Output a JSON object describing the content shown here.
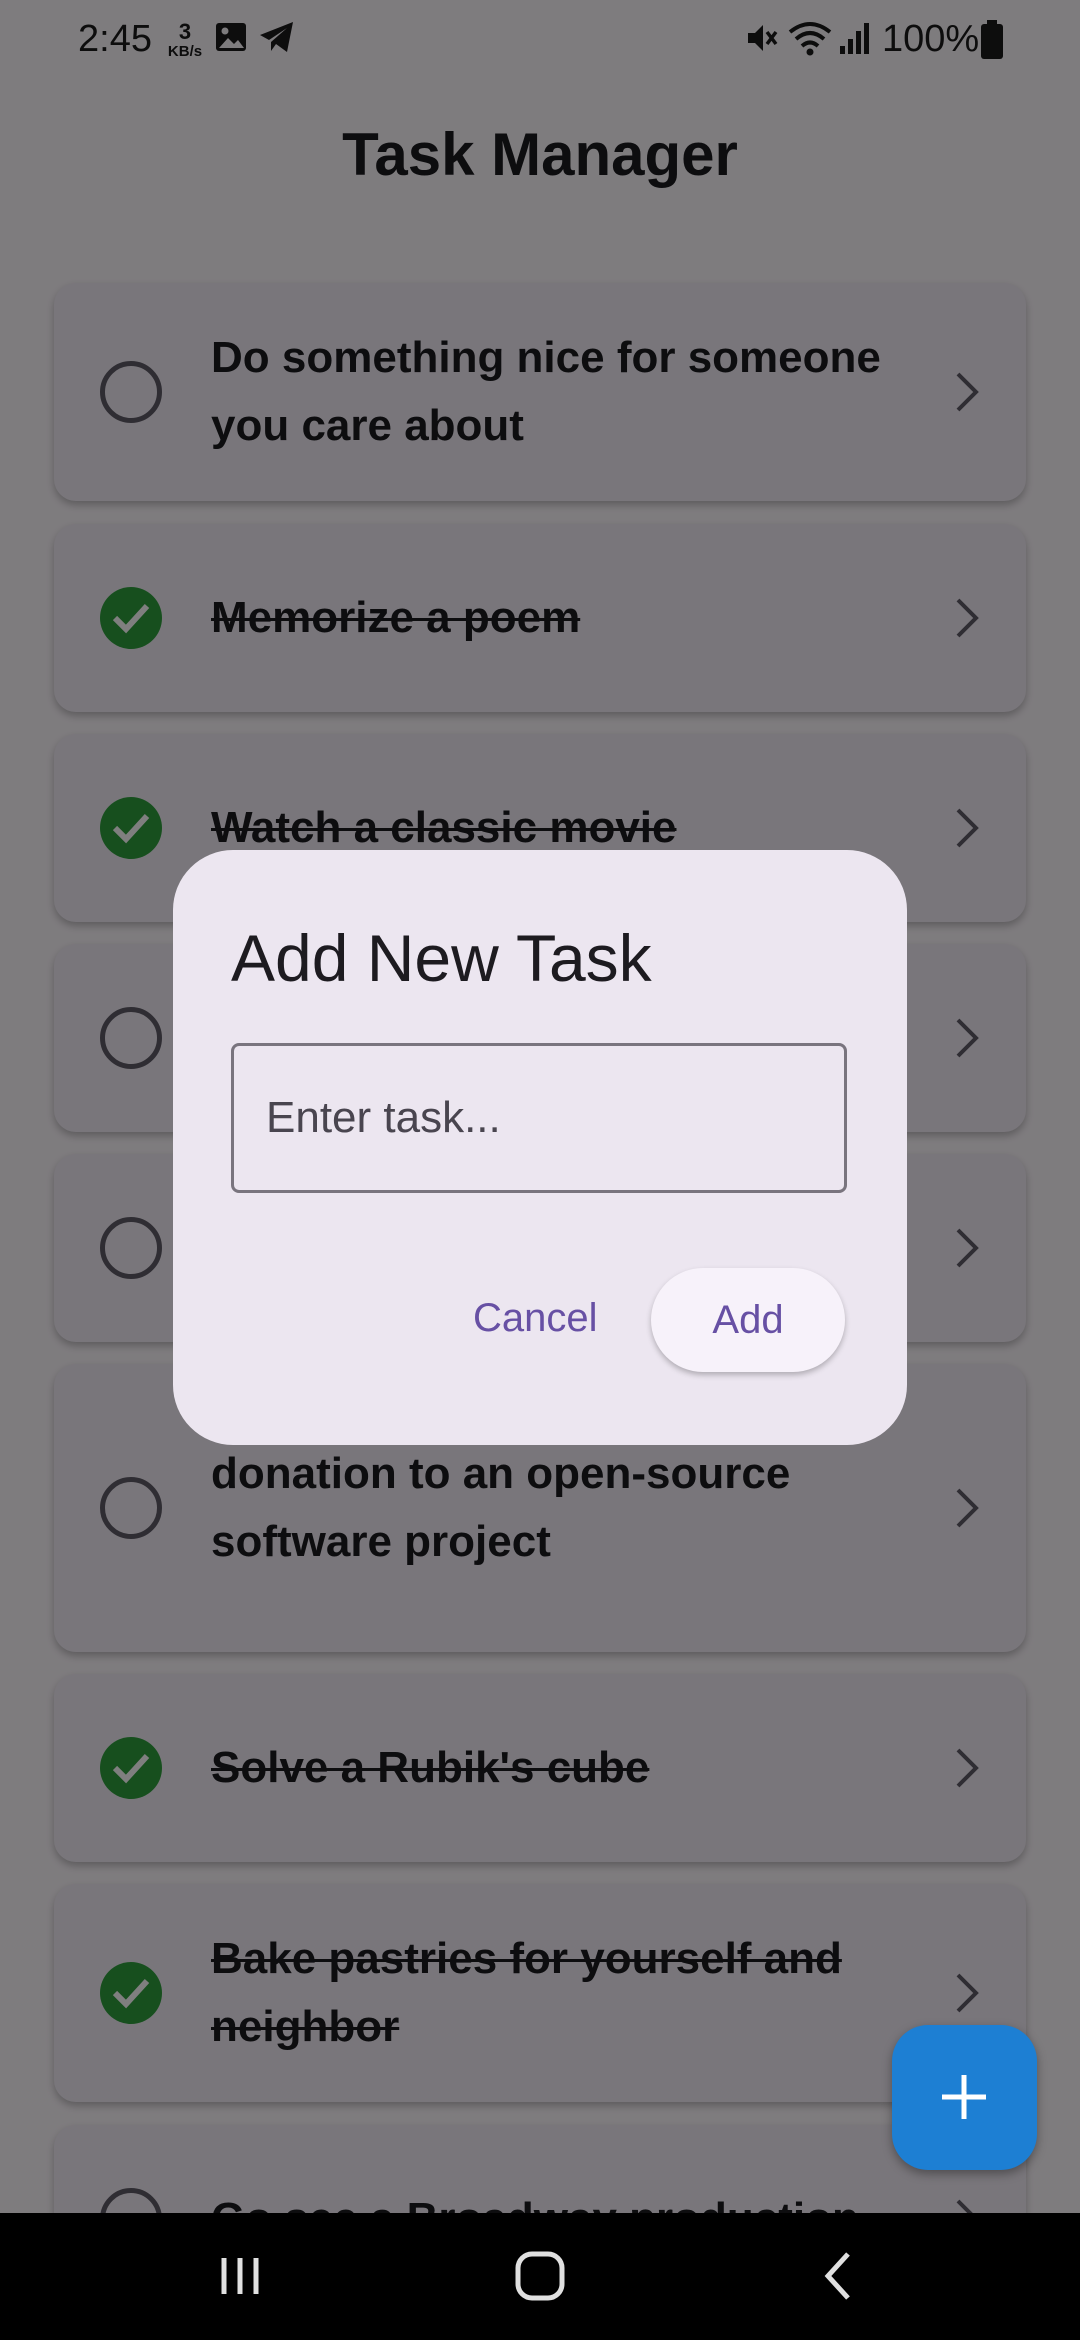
{
  "status_bar": {
    "time": "2:45",
    "net_speed_value": "3",
    "net_speed_unit": "KB/s",
    "battery": "100%"
  },
  "app_bar": {
    "title": "Task Manager"
  },
  "tasks": [
    {
      "text": "Do something nice for someone you care about",
      "done": false
    },
    {
      "text": "Memorize a poem",
      "done": true
    },
    {
      "text": "Watch a classic movie",
      "done": true
    },
    {
      "text": "",
      "done": false
    },
    {
      "text": "",
      "done": false
    },
    {
      "text": "Contribute code or a monetary donation to an open-source software project",
      "done": false
    },
    {
      "text": "Solve a Rubik's cube",
      "done": true
    },
    {
      "text": "Bake pastries for yourself and neighbor",
      "done": true
    },
    {
      "text": "Go see a Broadway production",
      "done": false
    }
  ],
  "dialog": {
    "title": "Add New Task",
    "input_placeholder": "Enter task...",
    "input_value": "",
    "cancel_label": "Cancel",
    "add_label": "Add"
  },
  "icons": {
    "fab": "plus-icon",
    "nav_recents": "recents-icon",
    "nav_home": "home-icon",
    "nav_back": "back-icon"
  },
  "colors": {
    "accent": "#6750a4",
    "done_green": "#2e9e3c",
    "fab_blue": "#1d7fd3"
  }
}
